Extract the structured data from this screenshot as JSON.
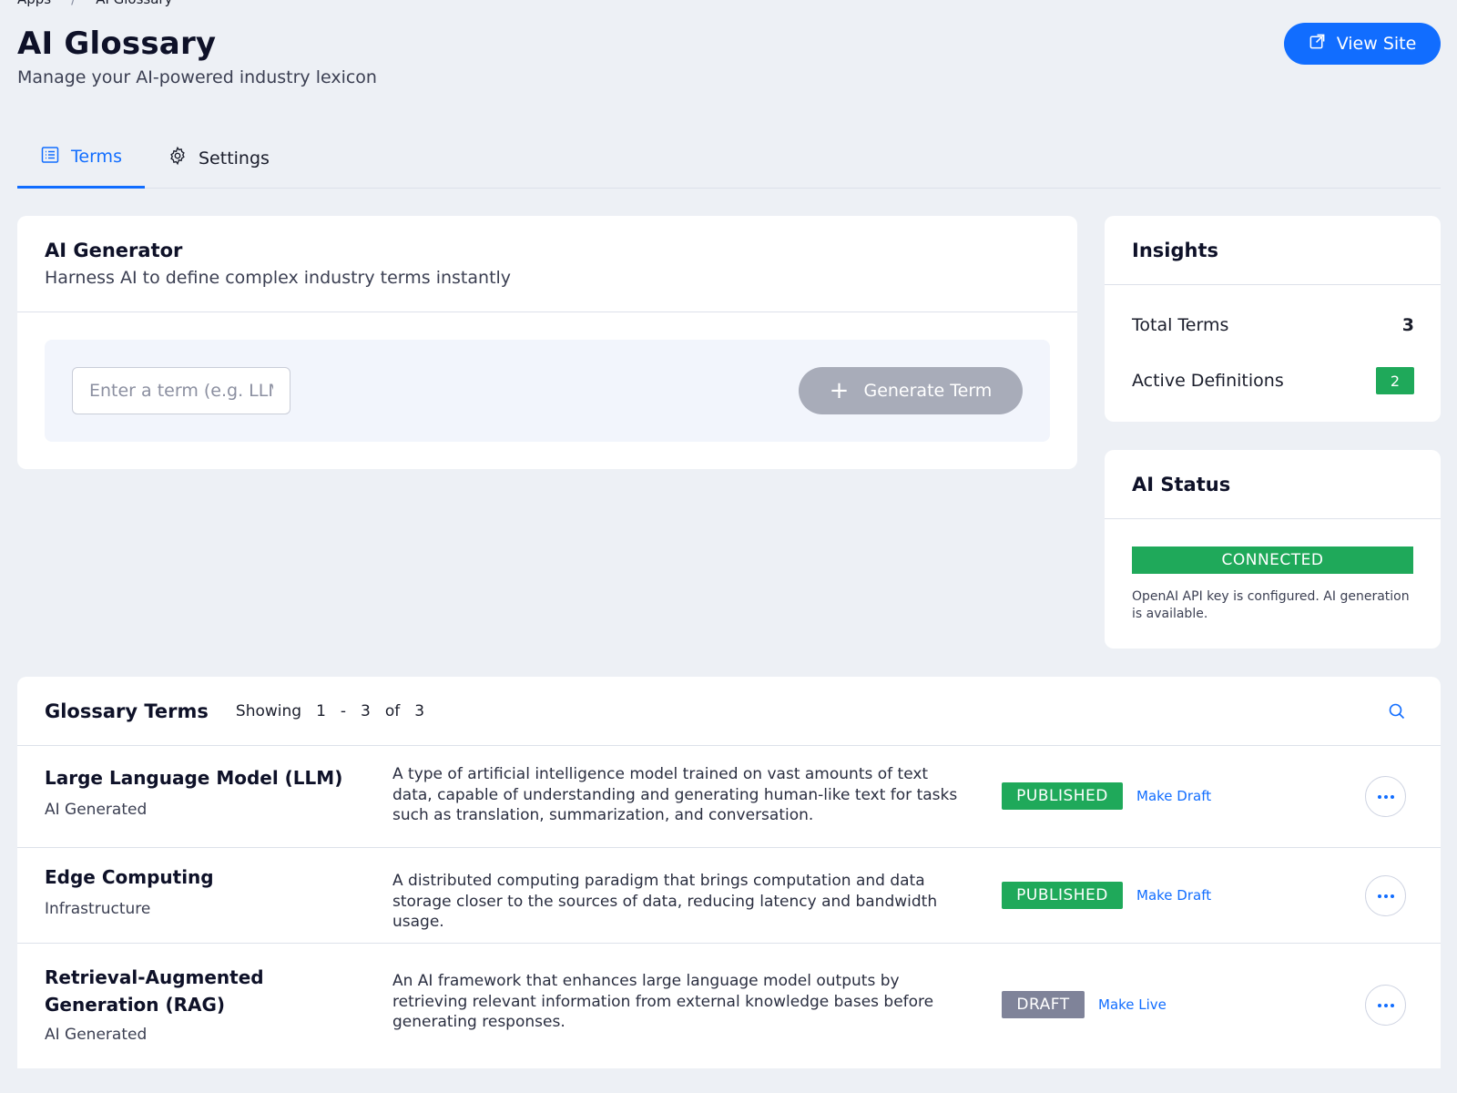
{
  "breadcrumb": {
    "items": [
      "Apps",
      "AI Glossary"
    ],
    "separator": "/"
  },
  "header": {
    "title": "AI Glossary",
    "subtitle": "Manage your AI-powered industry lexicon",
    "view_site_label": "View Site"
  },
  "tabs": [
    {
      "label": "Terms",
      "active": true,
      "icon": "list-icon"
    },
    {
      "label": "Settings",
      "active": false,
      "icon": "gear-icon"
    }
  ],
  "generator": {
    "title": "AI Generator",
    "subtitle": "Harness AI to define complex industry terms instantly",
    "input_placeholder": "Enter a term (e.g. LLM",
    "input_value": "",
    "generate_label": "Generate Term"
  },
  "insights": {
    "title": "Insights",
    "total_terms_label": "Total Terms",
    "total_terms_value": "3",
    "active_definitions_label": "Active Definitions",
    "active_definitions_value": "2"
  },
  "ai_status": {
    "title": "AI Status",
    "status": "CONNECTED",
    "note": "OpenAI API key is configured. AI generation is available."
  },
  "glossary": {
    "title": "Glossary Terms",
    "showing": {
      "label": "Showing",
      "from": "1",
      "dash": "-",
      "to": "3",
      "of_label": "of",
      "total": "3"
    },
    "rows": [
      {
        "name": "Large Language Model (LLM)",
        "category": "AI Generated",
        "definition": "A type of artificial intelligence model trained on vast amounts of text data, capable of understanding and generating human-like text for tasks such as translation, summarization, and conversation.",
        "status": "PUBLISHED",
        "action": "Make Draft"
      },
      {
        "name": "Edge Computing",
        "category": "Infrastructure",
        "definition": "A distributed computing paradigm that brings computation and data storage closer to the sources of data, reducing latency and bandwidth usage.",
        "status": "PUBLISHED",
        "action": "Make Draft"
      },
      {
        "name": "Retrieval-Augmented Generation (RAG)",
        "category": "AI Generated",
        "definition": "An AI framework that enhances large language model outputs by retrieving relevant information from external knowledge bases before generating responses.",
        "status": "DRAFT",
        "action": "Make Live"
      }
    ]
  },
  "colors": {
    "accent": "#116dff",
    "published": "#1fa95a",
    "draft": "#7f8399",
    "background": "#edf0f5"
  }
}
